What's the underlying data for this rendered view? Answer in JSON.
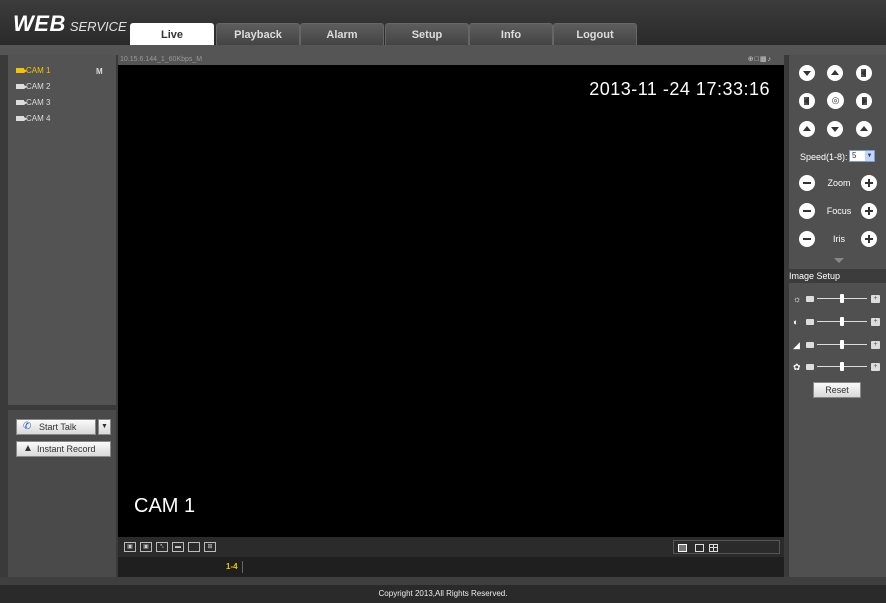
{
  "header": {
    "logo_main": "WEB",
    "logo_sub": "SERVICE",
    "tabs": [
      {
        "label": "Live",
        "active": true
      },
      {
        "label": "Playback",
        "active": false
      },
      {
        "label": "Alarm",
        "active": false
      },
      {
        "label": "Setup",
        "active": false
      },
      {
        "label": "Info",
        "active": false
      },
      {
        "label": "Logout",
        "active": false
      }
    ]
  },
  "cameras": {
    "items": [
      {
        "label": "CAM 1",
        "active": true
      },
      {
        "label": "CAM 2",
        "active": false
      },
      {
        "label": "CAM 3",
        "active": false
      },
      {
        "label": "CAM 4",
        "active": false
      }
    ],
    "stream_marker": "M"
  },
  "left_actions": {
    "start_talk": "Start Talk",
    "instant_record": "Instant Record"
  },
  "video": {
    "stream_info": "10.15.6.144_1_60Kbps_M",
    "timestamp": "2013-11 -24 17:33:16",
    "channel_name": "CAM 1",
    "page_label": "1-4"
  },
  "ptz": {
    "speed_label": "Speed(1-8):",
    "speed_value": "5",
    "rows": [
      {
        "label": "Zoom"
      },
      {
        "label": "Focus"
      },
      {
        "label": "Iris"
      }
    ]
  },
  "image_setup": {
    "title": "Image Setup",
    "reset_label": "Reset",
    "sliders": [
      {
        "name": "brightness",
        "icon": "sun-icon",
        "value": 0.5
      },
      {
        "name": "contrast",
        "icon": "contrast-icon",
        "value": 0.5
      },
      {
        "name": "saturation",
        "icon": "saturation-icon",
        "value": 0.5
      },
      {
        "name": "hue",
        "icon": "hue-icon",
        "value": 0.5
      }
    ]
  },
  "footer": {
    "copyright": "Copyright 2013,All Rights Reserved."
  }
}
